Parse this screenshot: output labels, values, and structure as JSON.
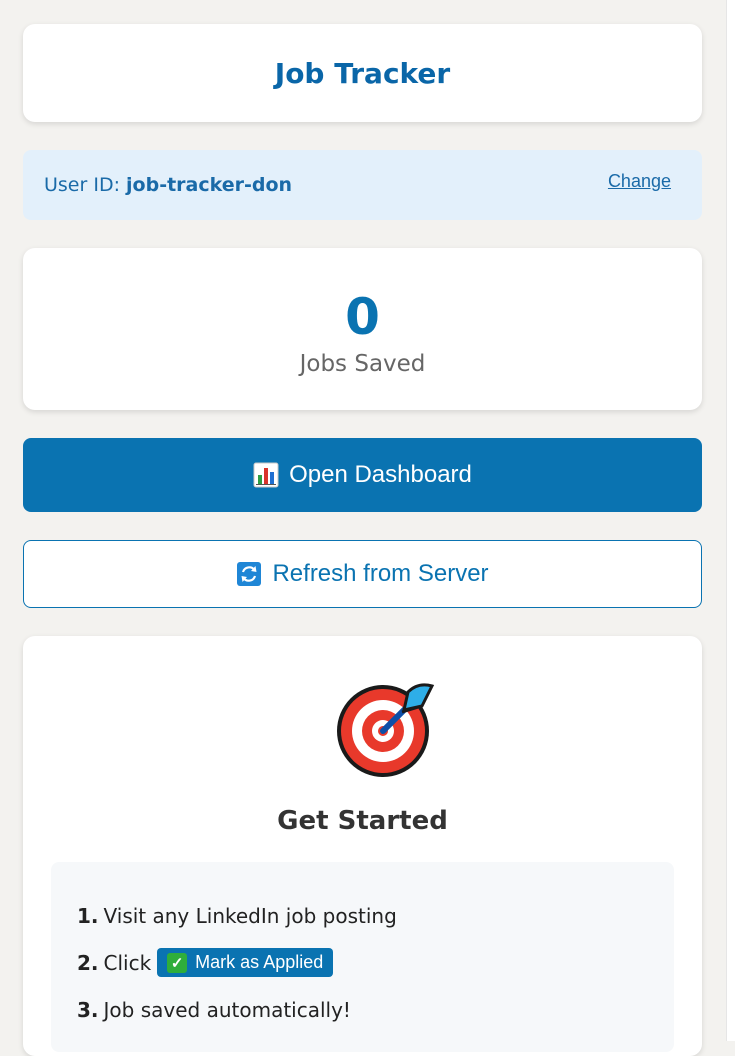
{
  "header": {
    "title": "Job Tracker"
  },
  "user": {
    "label": "User ID: ",
    "id": "job-tracker-don",
    "change_label": "Change"
  },
  "stats": {
    "count": "0",
    "label": "Jobs Saved"
  },
  "buttons": {
    "dashboard_label": "Open Dashboard",
    "dashboard_icon": "bar-chart-icon",
    "refresh_label": "Refresh from Server",
    "refresh_icon": "refresh-icon"
  },
  "get_started": {
    "icon": "target-icon",
    "title": "Get Started",
    "steps": [
      {
        "num": "1.",
        "text": "Visit any LinkedIn job posting"
      },
      {
        "num": "2.",
        "text": "Click",
        "badge_label": "Mark as Applied",
        "badge_icon": "checkmark-icon"
      },
      {
        "num": "3.",
        "text": "Job saved automatically!"
      }
    ]
  },
  "colors": {
    "primary": "#0a73b1",
    "title": "#0a66a8",
    "userid_bg": "#e3f0fb",
    "page_bg": "#f3f2ef"
  }
}
